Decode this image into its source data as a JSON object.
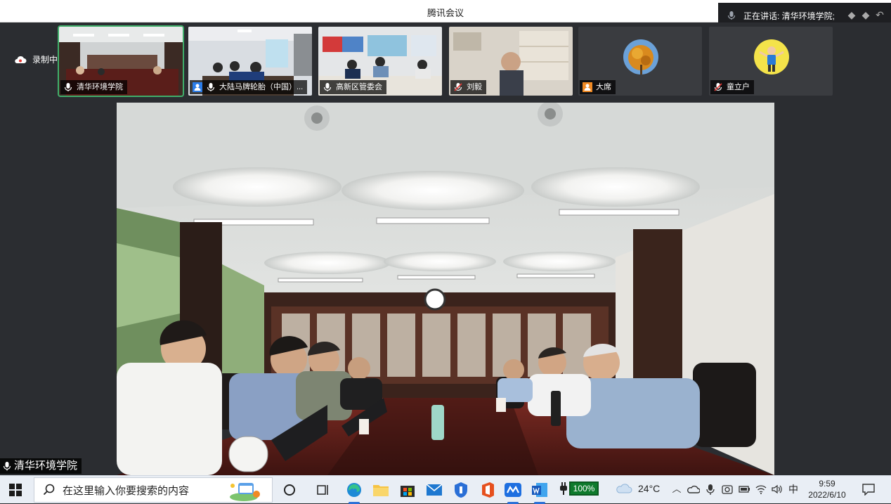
{
  "window": {
    "title": "腾讯会议"
  },
  "speaking": {
    "label": "正在讲话: 清华环境学院;"
  },
  "recording": {
    "label": "录制中"
  },
  "participants": [
    {
      "name": "清华环境学院",
      "mic": "on",
      "kind": "video"
    },
    {
      "name": "大陆马牌轮胎（中国）...",
      "mic": "on",
      "kind": "video"
    },
    {
      "name": "高新区管委会",
      "mic": "on",
      "kind": "video"
    },
    {
      "name": "刘毅",
      "mic": "muted",
      "kind": "video"
    },
    {
      "name": "大席",
      "mic": "none",
      "kind": "avatar"
    },
    {
      "name": "童立户",
      "mic": "muted",
      "kind": "avatar"
    }
  ],
  "main": {
    "speaker_label": "清华环境学院"
  },
  "taskbar": {
    "search_placeholder": "在这里输入你要搜索的内容",
    "battery": "100%",
    "weather_temp": "24°C",
    "ime": "中",
    "time": "9:59",
    "date": "2022/6/10",
    "apps": [
      "task-view",
      "edge",
      "file-explorer",
      "microsoft-store",
      "mail",
      "security",
      "office",
      "tencent-meeting",
      "word"
    ]
  },
  "colors": {
    "accent": "#3fae6a",
    "window_bg": "#2b2d31",
    "taskbar_bg": "#e9eef5"
  }
}
